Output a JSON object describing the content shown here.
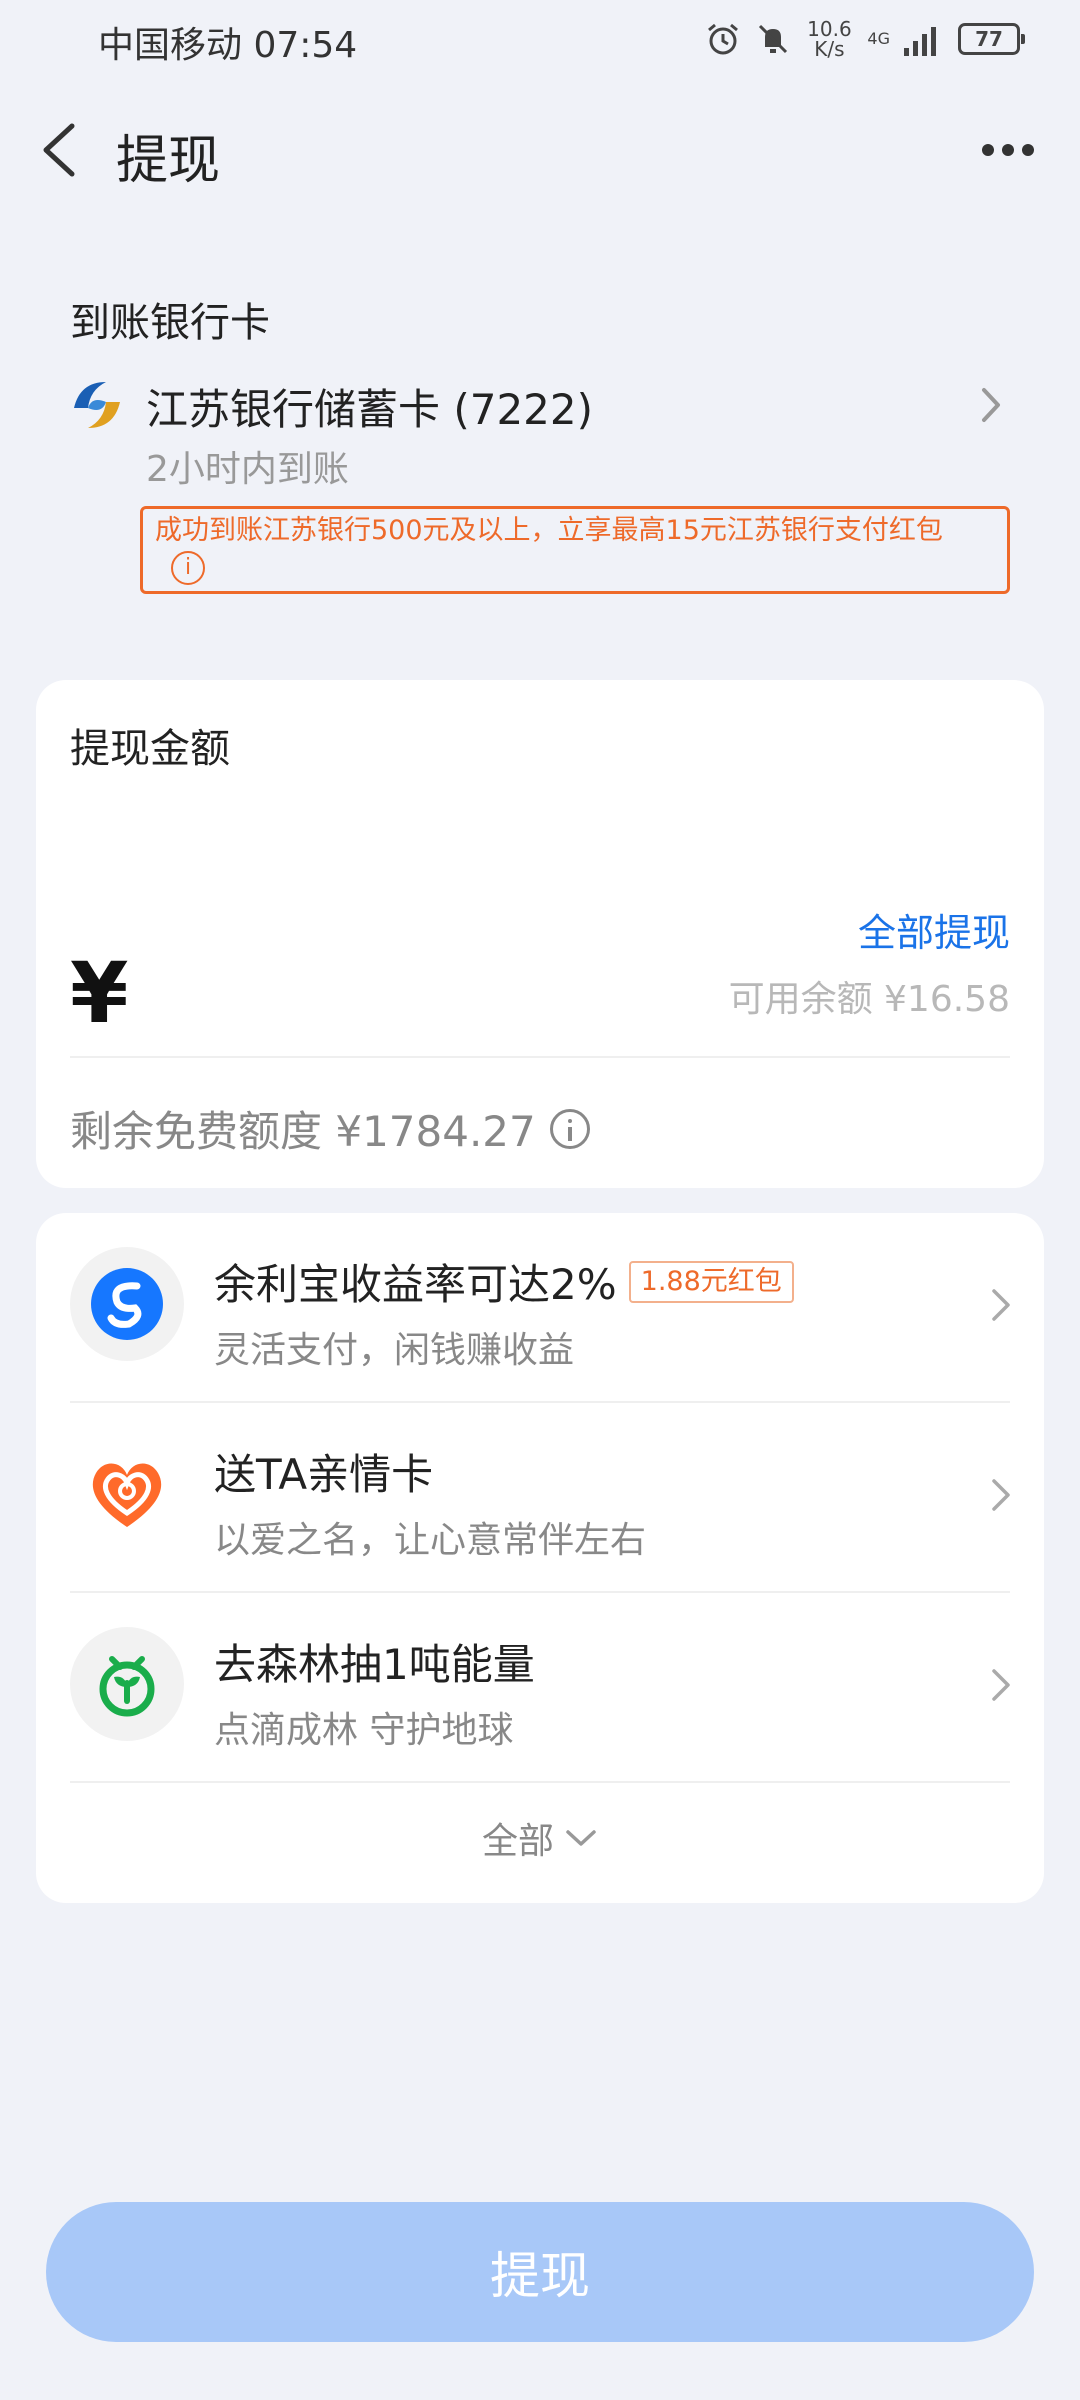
{
  "status_bar": {
    "carrier": "中国移动",
    "time": "07:54",
    "net_speed_value": "10.6",
    "net_speed_unit": "K/s",
    "network_type": "4G",
    "battery": "77",
    "icons": [
      "alarm-icon",
      "mute-icon",
      "signal-icon",
      "battery-icon"
    ]
  },
  "nav": {
    "title": "提现",
    "back_icon": "back-arrow-icon",
    "more_icon": "more-dots-icon"
  },
  "bank": {
    "label": "到账银行卡",
    "name": "江苏银行储蓄卡 (7222)",
    "arrival_time": "2小时内到账",
    "promo": "成功到账江苏银行500元及以上，立享最高15元江苏银行支付红包",
    "promo_info_icon": "i"
  },
  "amount": {
    "label": "提现金额",
    "withdraw_all": "全部提现",
    "currency": "¥",
    "balance": "可用余额 ¥16.58",
    "free_quota": "剩余免费额度 ¥1784.27"
  },
  "services": [
    {
      "title": "余利宝收益率可达2%",
      "badge": "1.88元红包",
      "subtitle": "灵活支付，闲钱赚收益",
      "icon": "yulibao-icon"
    },
    {
      "title": "送TA亲情卡",
      "badge": "",
      "subtitle": "以爱之名，让心意常伴左右",
      "icon": "heart-card-icon"
    },
    {
      "title": "去森林抽1吨能量",
      "badge": "",
      "subtitle": "点滴成林 守护地球",
      "icon": "forest-sprout-icon"
    }
  ],
  "expand": {
    "label": "全部"
  },
  "submit": {
    "label": "提现"
  },
  "colors": {
    "background": "#f0f2f8",
    "accent_blue": "#1a73e8",
    "promo_orange": "#ee6a2a",
    "button_disabled": "#a8c8f8"
  }
}
